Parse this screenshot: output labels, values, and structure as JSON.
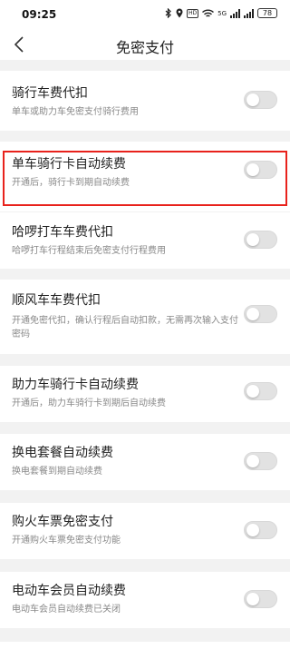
{
  "status_bar": {
    "time": "09:25",
    "hd_label": "HD",
    "network": "5G",
    "battery": "78"
  },
  "header": {
    "title": "免密支付"
  },
  "items": [
    {
      "title": "骑行车费代扣",
      "subtitle": "单车或助力车免密支付骑行费用",
      "enabled": false
    },
    {
      "title": "单车骑行卡自动续费",
      "subtitle": "开通后，骑行卡到期自动续费",
      "enabled": false
    },
    {
      "title": "哈啰打车车费代扣",
      "subtitle": "哈啰打车行程结束后免密支付行程费用",
      "enabled": false
    },
    {
      "title": "顺风车车费代扣",
      "subtitle": "开通免密代扣，确认行程后自动扣款，无需再次输入支付密码",
      "enabled": false
    },
    {
      "title": "助力车骑行卡自动续费",
      "subtitle": "开通后，助力车骑行卡到期后自动续费",
      "enabled": false
    },
    {
      "title": "换电套餐自动续费",
      "subtitle": "换电套餐到期自动续费",
      "enabled": false
    },
    {
      "title": "购火车票免密支付",
      "subtitle": "开通购火车票免密支付功能",
      "enabled": false
    },
    {
      "title": "电动车会员自动续费",
      "subtitle": "电动车会员自动续费已关闭",
      "enabled": false
    }
  ],
  "colors": {
    "highlight_border": "#e8221c",
    "toggle_off": "#e2e2e2",
    "page_background": "#f2f2f2"
  }
}
